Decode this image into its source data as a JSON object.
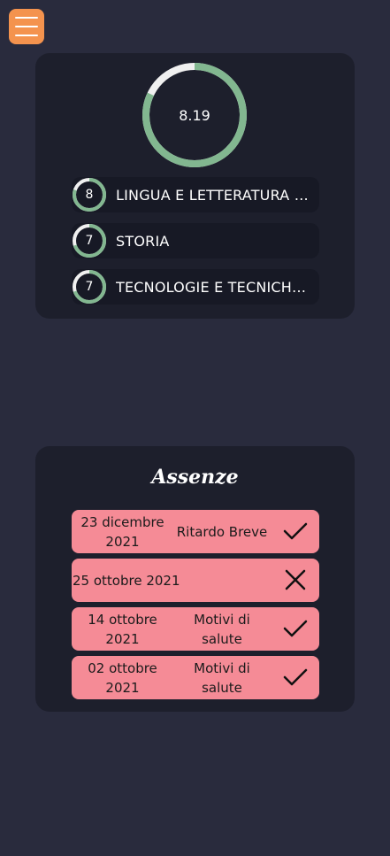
{
  "menu": {
    "icon": "hamburger-menu-icon"
  },
  "colors": {
    "background": "#292b3d",
    "card": "#1d1f2c",
    "row": "#171925",
    "ring_progress": "#82b790",
    "ring_track": "#f0f0f0",
    "menu_button": "#f4934e",
    "absence_row": "#f58b96"
  },
  "grades": {
    "average": {
      "value": "8.19",
      "progress": 0.82
    },
    "subjects": [
      {
        "grade": "8",
        "name": "LINGUA E LETTERATURA ITALIANA",
        "progress": 0.8
      },
      {
        "grade": "7",
        "name": "STORIA",
        "progress": 0.7
      },
      {
        "grade": "7",
        "name": "TECNOLOGIE E TECNICHE DI RAPPRESENTAZIONE GRAFICA",
        "progress": 0.7
      }
    ]
  },
  "absences": {
    "title": "Assenze",
    "items": [
      {
        "date": "23 dicembre 2021",
        "reason": "Ritardo Breve",
        "status": "check-icon"
      },
      {
        "date": "25 ottobre 2021",
        "reason": "",
        "status": "cross-icon"
      },
      {
        "date": "14 ottobre 2021",
        "reason": "Motivi di salute",
        "status": "check-icon"
      },
      {
        "date": "02 ottobre 2021",
        "reason": "Motivi di salute",
        "status": "check-icon"
      }
    ]
  }
}
